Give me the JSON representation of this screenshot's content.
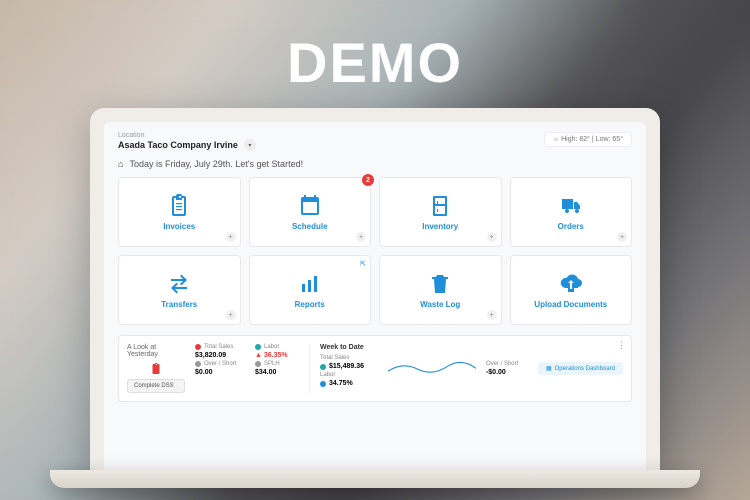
{
  "demo_text": "DEMO",
  "location": {
    "label": "Location",
    "name": "Asada Taco Company Irvine"
  },
  "weather": {
    "text": "High: 82° | Low: 65°"
  },
  "greeting": "Today is Friday, July 29th. Let's get Started!",
  "tiles": [
    {
      "label": "Invoices"
    },
    {
      "label": "Schedule",
      "badge": "2"
    },
    {
      "label": "Inventory"
    },
    {
      "label": "Orders"
    },
    {
      "label": "Transfers"
    },
    {
      "label": "Reports"
    },
    {
      "label": "Waste Log"
    },
    {
      "label": "Upload Documents"
    }
  ],
  "summary": {
    "yesterday": {
      "title": "A Look at Yesterday",
      "button": "Complete DSS",
      "sales_lbl": "Total Sales",
      "sales_val": "$3,820.09",
      "over_lbl": "Over / Short",
      "over_val": "$0.00",
      "labor_lbl": "Labor",
      "labor_val": "▲ 36.35%",
      "splh_lbl": "SPLH",
      "splh_val": "$34.00"
    },
    "wtd": {
      "title": "Week to Date",
      "sales_lbl": "Total Sales",
      "sales_val": "$15,489.36",
      "labor_lbl": "Labor",
      "labor_val": "34.75%",
      "over_lbl": "Over / Short",
      "over_val": "-$0.00"
    },
    "ops_button": "Operations Dashboard"
  }
}
